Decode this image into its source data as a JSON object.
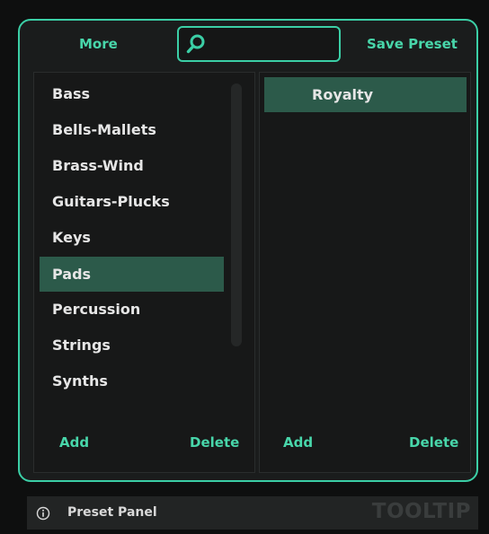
{
  "toolbar": {
    "more_label": "More",
    "save_preset_label": "Save Preset",
    "search_value": ""
  },
  "categories": {
    "items": [
      {
        "label": "Bass"
      },
      {
        "label": "Bells-Mallets"
      },
      {
        "label": "Brass-Wind"
      },
      {
        "label": "Guitars-Plucks"
      },
      {
        "label": "Keys"
      },
      {
        "label": "Pads",
        "selected": true
      },
      {
        "label": "Percussion"
      },
      {
        "label": "Strings"
      },
      {
        "label": "Synths"
      }
    ],
    "add_label": "Add",
    "delete_label": "Delete"
  },
  "presets": {
    "items": [
      {
        "label": "Royalty",
        "selected": true
      }
    ],
    "add_label": "Add",
    "delete_label": "Delete"
  },
  "tooltip": {
    "icon": "info-icon",
    "text": "Preset Panel",
    "brand": "TOOLTIP"
  },
  "colors": {
    "accent": "#3bcfa6",
    "selected_bg": "#2c5a4a",
    "panel_bg": "#171818",
    "frame_bg": "#1a1c1c"
  }
}
